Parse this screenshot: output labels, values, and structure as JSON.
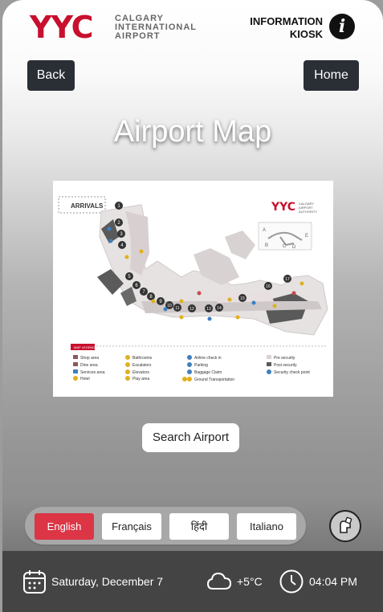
{
  "header": {
    "logo": "YYC",
    "logo_line1": "CALGARY",
    "logo_line2": "INTERNATIONAL",
    "logo_line3": "AIRPORT",
    "info_line1": "INFORMATION",
    "info_line2": "KIOSK",
    "info_icon": "info-icon"
  },
  "nav": {
    "back_label": "Back",
    "home_label": "Home"
  },
  "page_title": "Airport Map",
  "map": {
    "heading": "ARRIVALS",
    "brand": "YYC",
    "brand_sub1": "CALGARY",
    "brand_sub2": "AIRPORT",
    "brand_sub3": "AUTHORITY",
    "zone_labels": [
      "A",
      "B",
      "C",
      "D",
      "E"
    ],
    "gates": [
      "1",
      "2",
      "3",
      "4",
      "5",
      "6",
      "7",
      "8",
      "9",
      "10",
      "11",
      "12",
      "13",
      "14",
      "15",
      "16",
      "17"
    ],
    "legend_title": "MAP LEGEND",
    "legend": [
      "Shop area",
      "Dine area",
      "Services area",
      "Hotel",
      "Bathrooms",
      "Escalators",
      "Elevators",
      "Play area",
      "Airline check in",
      "Parking",
      "Baggage Claim",
      "Ground Transportation",
      "Pre security",
      "Post security",
      "Security check point"
    ]
  },
  "search_label": "Search Airport",
  "languages": [
    {
      "label": "English",
      "active": true
    },
    {
      "label": "Français",
      "active": false
    },
    {
      "label": "हिंदी",
      "active": false
    },
    {
      "label": "Italiano",
      "active": false
    }
  ],
  "footer": {
    "date": "Saturday, December 7",
    "temperature": "+5°C",
    "time": "04:04 PM"
  },
  "colors": {
    "accent": "#c8102e",
    "button_dark": "#2a2e35",
    "active_lang": "#dc3545",
    "footer": "#444444"
  }
}
